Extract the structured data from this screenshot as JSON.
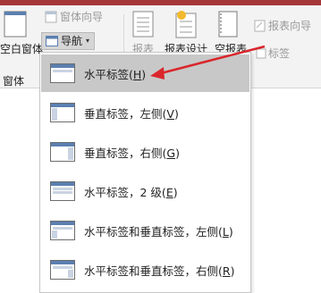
{
  "ribbon": {
    "form_wizard": "窗体向导",
    "navigation": "导航",
    "blank_form": "空白窗体",
    "group_form": "窗体",
    "report": "报表",
    "report_design": "报表设计",
    "blank_report": "空报表",
    "report_wizard": "报表向导",
    "labels": "标签"
  },
  "menu": {
    "items": [
      {
        "label": "水平标签(",
        "key": "H",
        "end": ")",
        "selected": true
      },
      {
        "label": "垂直标签，左侧(",
        "key": "V",
        "end": ")",
        "selected": false
      },
      {
        "label": "垂直标签，右侧(",
        "key": "G",
        "end": ")",
        "selected": false
      },
      {
        "label": "水平标签，2 级(",
        "key": "E",
        "end": ")",
        "selected": false
      },
      {
        "label": "水平标签和垂直标签，左侧(",
        "key": "L",
        "end": ")",
        "selected": false
      },
      {
        "label": "水平标签和垂直标签，右侧(",
        "key": "R",
        "end": ")",
        "selected": false
      }
    ]
  },
  "colors": {
    "arrow": "#d9262b",
    "titlebar": "#a4373a",
    "selected": "#c8c8c8",
    "icon_blue": "#5b7fb0"
  }
}
